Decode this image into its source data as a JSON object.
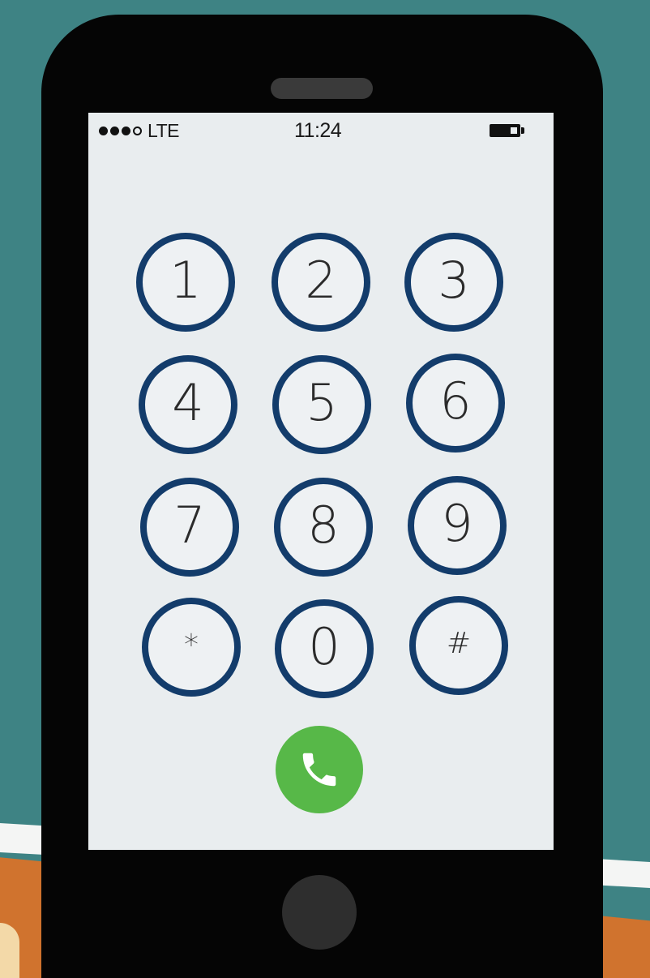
{
  "status_bar": {
    "signal_dots": 4,
    "carrier": "LTE",
    "time": "11:24",
    "battery_icon": "battery-icon"
  },
  "keypad": {
    "keys": [
      "1",
      "2",
      "3",
      "4",
      "5",
      "6",
      "7",
      "8",
      "9",
      "*",
      "0",
      "#"
    ]
  },
  "call": {
    "icon": "phone-icon",
    "color": "#57b848"
  },
  "colors": {
    "key_ring": "#133c6b",
    "wall": "#3e8384",
    "counter": "#d0732e",
    "phone_body": "#050505",
    "screen": "#e9edef"
  }
}
